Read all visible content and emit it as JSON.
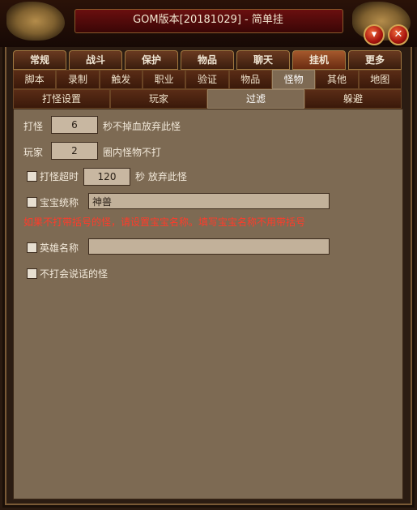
{
  "window": {
    "title": "GOM版本[20181029] - 简单挂"
  },
  "titlebar_buttons": {
    "minimize_icon": "▾",
    "close_icon": "✕"
  },
  "tabs_row1": [
    {
      "label": "常规",
      "active": false
    },
    {
      "label": "战斗",
      "active": false
    },
    {
      "label": "保护",
      "active": false
    },
    {
      "label": "物品",
      "active": false
    },
    {
      "label": "聊天",
      "active": false
    },
    {
      "label": "挂机",
      "active": true
    },
    {
      "label": "更多",
      "active": false
    }
  ],
  "tabs_row2": [
    {
      "label": "脚本",
      "active": false
    },
    {
      "label": "录制",
      "active": false
    },
    {
      "label": "触发",
      "active": false
    },
    {
      "label": "职业",
      "active": false
    },
    {
      "label": "验证",
      "active": false
    },
    {
      "label": "物品",
      "active": false
    },
    {
      "label": "怪物",
      "active": true
    },
    {
      "label": "其他",
      "active": false
    },
    {
      "label": "地图",
      "active": false
    }
  ],
  "tabs_row3": [
    {
      "label": "打怪设置",
      "active": false
    },
    {
      "label": "玩家",
      "active": false
    },
    {
      "label": "过滤",
      "active": true
    },
    {
      "label": "躲避",
      "active": false
    }
  ],
  "settings": {
    "fight_label": "打怪",
    "fight_value": "6",
    "fight_suffix": "秒不掉血放弃此怪",
    "player_label": "玩家",
    "player_value": "2",
    "player_suffix": "圈内怪物不打",
    "timeout_label": "打怪超时",
    "timeout_value": "120",
    "timeout_suffix": "秒 放弃此怪",
    "pet_label": "宝宝统称",
    "pet_value": "神兽",
    "warning": "如果不打带括号的怪，请设置宝宝名称。填写宝宝名称不用带括号",
    "hero_label": "英雄名称",
    "hero_value": "",
    "no_talk_label": "不打会说话的怪"
  }
}
